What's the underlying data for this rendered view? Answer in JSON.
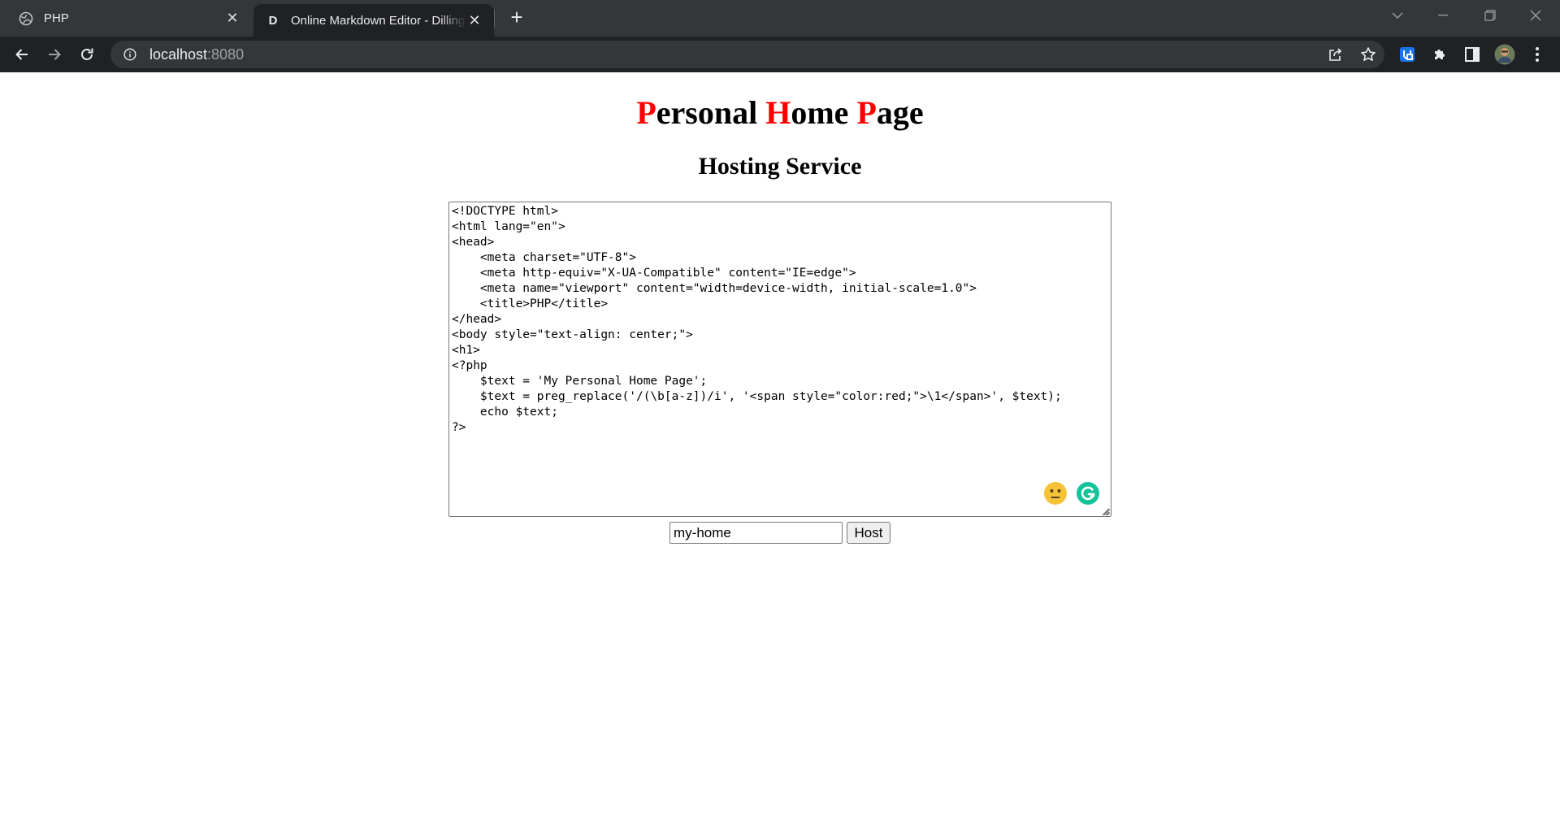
{
  "browser": {
    "tabs": [
      {
        "title": "PHP",
        "active": false,
        "favicon": "globe-icon"
      },
      {
        "title": "Online Markdown Editor - Dillinger",
        "active": true,
        "favicon": "D"
      }
    ],
    "address": {
      "host": "localhost",
      "port": ":8080"
    },
    "colors": {
      "tabstrip": "#35363a",
      "toolbar": "#202124",
      "omnibox": "#35363a"
    }
  },
  "page": {
    "heading": {
      "words": [
        {
          "initial": "P",
          "rest": "ersonal "
        },
        {
          "initial": "H",
          "rest": "ome "
        },
        {
          "initial": "P",
          "rest": "age"
        }
      ],
      "initial_color": "#ff0000"
    },
    "subheading": "Hosting Service",
    "code": "<!DOCTYPE html>\n<html lang=\"en\">\n<head>\n    <meta charset=\"UTF-8\">\n    <meta http-equiv=\"X-UA-Compatible\" content=\"IE=edge\">\n    <meta name=\"viewport\" content=\"width=device-width, initial-scale=1.0\">\n    <title>PHP</title>\n</head>\n<body style=\"text-align: center;\">\n<h1>\n<?php\n    $text = 'My Personal Home Page';\n    $text = preg_replace('/(\\b[a-z])/i', '<span style=\"color:red;\">\\1</span>', $text);\n    echo $text;\n?>",
    "name_input": {
      "value": "my-home"
    },
    "host_button": {
      "label": "Host"
    }
  }
}
